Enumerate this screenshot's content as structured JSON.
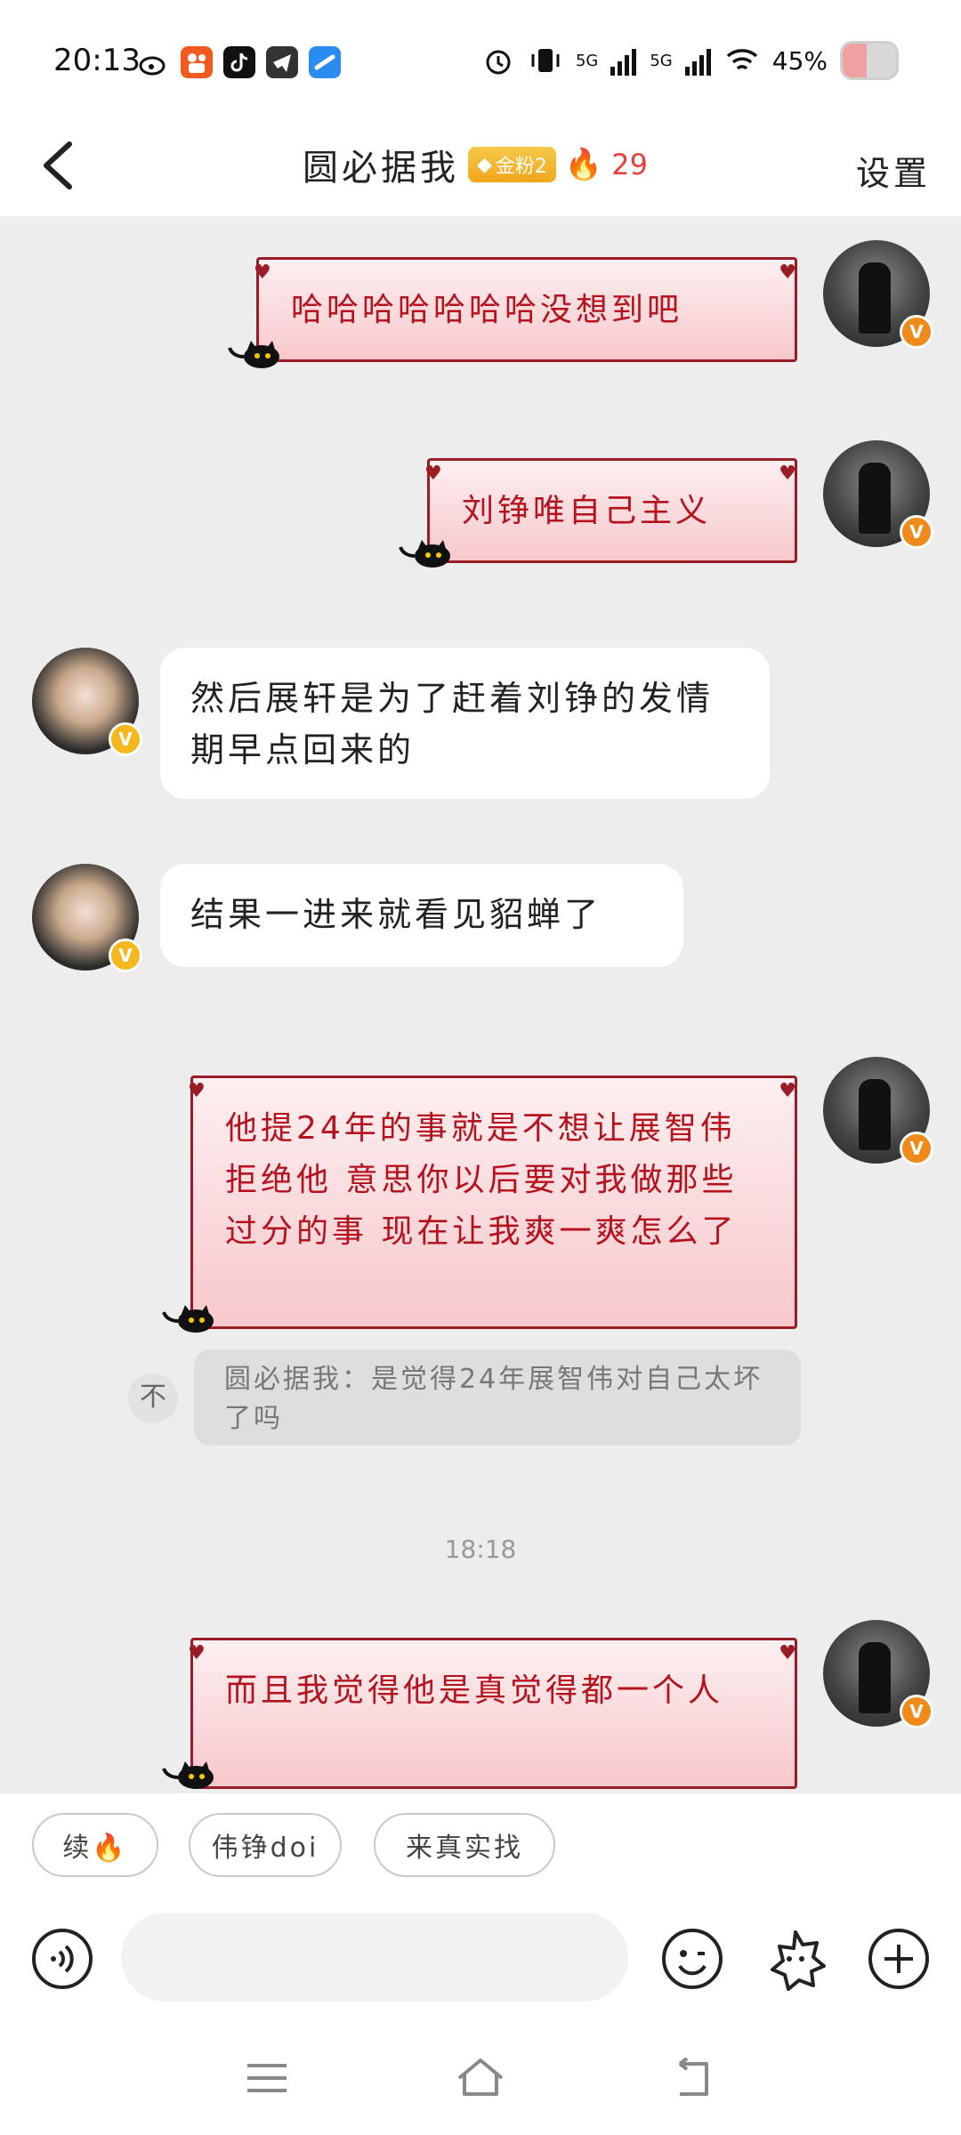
{
  "status_bar": {
    "time": "20:13",
    "network_1": "5G",
    "network_2": "5G",
    "battery": "45%",
    "battery_level": 0.45
  },
  "header": {
    "title": "圆必据我",
    "fan_badge": "金粉2",
    "fire_count": "29",
    "settings_label": "设置"
  },
  "messages": [
    {
      "side": "right",
      "text": "哈哈哈哈哈哈哈没想到吧"
    },
    {
      "side": "right",
      "text": "刘铮唯自己主义"
    },
    {
      "side": "left",
      "text": "然后展轩是为了赶着刘铮的发情期早点回来的"
    },
    {
      "side": "left",
      "text": "结果一进来就看见貂蝉了"
    },
    {
      "side": "right",
      "text": "他提24年的事就是不想让展智伟拒绝他 意思你以后要对我做那些过分的事 现在让我爽一爽怎么了"
    },
    {
      "side": "right",
      "text": "而且我觉得他是真觉得都一个人"
    }
  ],
  "quote": {
    "text": "圆必据我：是觉得24年展智伟对自己太坏了吗",
    "icon": "不"
  },
  "timestamp": "18:18",
  "quick_replies": [
    "续🔥",
    "伟铮doi",
    "来真实找"
  ],
  "colors": {
    "accent_red": "#b5121e",
    "bubble_border": "#9a1c26",
    "badge_gold": "#f0a61c",
    "verified_orange": "#f08a1a"
  }
}
